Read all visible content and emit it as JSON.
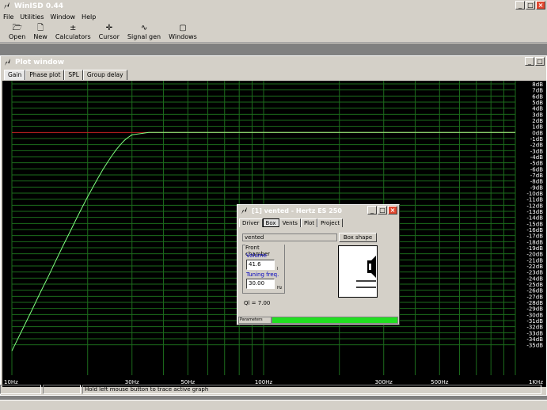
{
  "app": {
    "title": "WinISD 0.44"
  },
  "menu": [
    "File",
    "Utilities",
    "Window",
    "Help"
  ],
  "toolbar": [
    {
      "label": "Open",
      "icon": "open-folder-icon",
      "glyph": "🗁"
    },
    {
      "label": "New",
      "icon": "new-document-icon",
      "glyph": "🗋"
    },
    {
      "label": "Calculators",
      "icon": "calculator-icon",
      "glyph": "±"
    },
    {
      "label": "Cursor",
      "icon": "cursor-icon",
      "glyph": "✛"
    },
    {
      "label": "Signal gen",
      "icon": "signal-gen-icon",
      "glyph": "∿"
    },
    {
      "label": "Windows",
      "icon": "windows-icon",
      "glyph": "▢"
    }
  ],
  "plot_window": {
    "title": "Plot window",
    "tabs": [
      "Gain",
      "Phase plot",
      "SPL",
      "Group delay"
    ],
    "active_tab": 0
  },
  "dialog": {
    "title": "[1] vented - Hertz ES 250",
    "tabs": [
      "Driver",
      "Box",
      "Vents",
      "Plot",
      "Project"
    ],
    "active_tab": 1,
    "box_type": "vented",
    "box_shape_button": "Box shape",
    "front_chamber_label": "Front chamber",
    "volume_label": "Volume",
    "volume_value": "41.6",
    "volume_unit": "l",
    "tuning_label": "Tuning freq.",
    "tuning_value": "30.00",
    "tuning_unit": "Hz",
    "ql": "Ql = 7.00",
    "status_left": "Parameters",
    "progress": 1.0
  },
  "status_bar": {
    "message": "Hold left mouse button to trace active graph"
  },
  "colors": {
    "plot_bg": "#000000",
    "grid": "#1c6b1c",
    "zero_line": "#c02020",
    "curve": "#80ff80",
    "progress": "#20e020"
  },
  "chart_data": {
    "type": "line",
    "x_scale": "log",
    "xlim": [
      10,
      1000
    ],
    "ylim": [
      -40,
      8
    ],
    "x_tick_labels": [
      {
        "x": 10,
        "label": "10Hz"
      },
      {
        "x": 30,
        "label": "30Hz"
      },
      {
        "x": 50,
        "label": "50Hz"
      },
      {
        "x": 100,
        "label": "100Hz"
      },
      {
        "x": 300,
        "label": "300Hz"
      },
      {
        "x": 500,
        "label": "500Hz"
      },
      {
        "x": 1000,
        "label": "1KHz"
      }
    ],
    "x_gridlines": [
      10,
      20,
      30,
      40,
      50,
      60,
      70,
      80,
      90,
      100,
      200,
      300,
      400,
      500,
      600,
      700,
      800,
      900,
      1000
    ],
    "y_tick_labels": [
      "8dB",
      "7dB",
      "6dB",
      "5dB",
      "4dB",
      "3dB",
      "2dB",
      "1dB",
      "0dB",
      "-1dB",
      "-2dB",
      "-3dB",
      "-4dB",
      "-5dB",
      "-6dB",
      "-7dB",
      "-8dB",
      "-9dB",
      "-10dB",
      "-11dB",
      "-12dB",
      "-13dB",
      "-14dB",
      "-15dB",
      "-16dB",
      "-17dB",
      "-18dB",
      "-19dB",
      "-20dB",
      "-21dB",
      "-22dB",
      "-23dB",
      "-24dB",
      "-25dB",
      "-26dB",
      "-27dB",
      "-28dB",
      "-29dB",
      "-30dB",
      "-31dB",
      "-32dB",
      "-33dB",
      "-34dB",
      "-35dB"
    ],
    "series": [
      {
        "x": [
          10,
          11,
          12,
          13,
          14,
          15,
          16,
          17,
          18,
          19,
          20,
          21,
          22,
          23,
          24,
          25,
          26,
          27,
          28,
          29,
          30,
          35,
          40,
          50,
          70,
          100,
          200,
          500,
          1000
        ],
        "y": [
          -36.0,
          -32.5,
          -29.3,
          -26.3,
          -23.6,
          -21.0,
          -18.6,
          -16.4,
          -14.3,
          -12.4,
          -10.6,
          -9.0,
          -7.5,
          -6.1,
          -4.9,
          -3.8,
          -2.8,
          -2.0,
          -1.3,
          -0.8,
          -0.4,
          0.0,
          0.0,
          0.0,
          0.0,
          0.0,
          0.0,
          0.0,
          0.0
        ]
      }
    ]
  }
}
